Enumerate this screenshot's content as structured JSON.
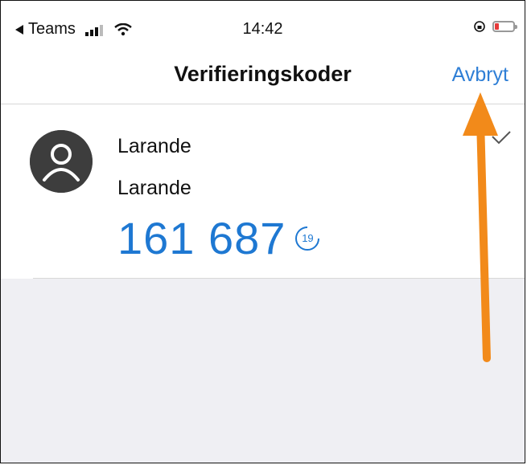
{
  "status_bar": {
    "back_app_label": "Teams",
    "time": "14:42",
    "icons": [
      "back-arrow-icon",
      "signal-icon",
      "wifi-icon",
      "rotation-lock-icon",
      "battery-icon"
    ]
  },
  "nav": {
    "title": "Verifieringskoder",
    "cancel_label": "Avbryt"
  },
  "account": {
    "issuer": "Larande",
    "account_name": "Larande",
    "code": "161 687",
    "seconds_remaining": "19"
  },
  "colors": {
    "accent": "#1e78d2",
    "nav_link": "#2f7fd6",
    "annotation_arrow": "#f28a1a",
    "avatar": "#3d3d3d",
    "background_empty": "#efeff3"
  }
}
